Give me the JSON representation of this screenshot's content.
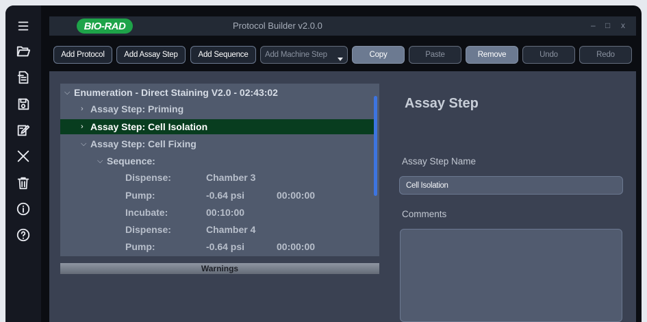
{
  "app": {
    "logo_text": "BIO-RAD",
    "title": "Protocol Builder v2.0.0",
    "window_controls": {
      "minimize": "–",
      "maximize": "□",
      "close": "x"
    },
    "colors": {
      "logo_green": "#1ea349",
      "selected_row": "#083d1f",
      "scrollbar": "#3d74e0",
      "panel": "#505a6d"
    }
  },
  "sidebar": {
    "icons": [
      "menu-icon",
      "open-folder-icon",
      "export-document-icon",
      "save-icon",
      "edit-document-icon",
      "close-icon",
      "delete-icon",
      "info-icon",
      "help-icon"
    ]
  },
  "toolbar": {
    "add_protocol": "Add Protocol",
    "add_assay_step": "Add Assay Step",
    "add_sequence": "Add Sequence",
    "add_machine_step": "Add Machine Step",
    "copy": "Copy",
    "paste": "Paste",
    "remove": "Remove",
    "undo": "Undo",
    "redo": "Redo"
  },
  "tree": {
    "root": "Enumeration - Direct Staining V2.0 - 02:43:02",
    "step1": "Assay Step: Priming",
    "step2": "Assay Step: Cell Isolation",
    "step3": "Assay Step: Cell Fixing",
    "sequence": "Sequence:",
    "rows": [
      {
        "action": "Dispense:",
        "value": "Chamber 3",
        "time": ""
      },
      {
        "action": "Pump:",
        "value": "-0.64 psi",
        "time": "00:00:00"
      },
      {
        "action": "Incubate:",
        "value": "00:10:00",
        "time": ""
      },
      {
        "action": "Dispense:",
        "value": "Chamber 4",
        "time": ""
      },
      {
        "action": "Pump:",
        "value": "-0.64 psi",
        "time": "00:00:00"
      }
    ]
  },
  "warnings": {
    "label": "Warnings"
  },
  "details": {
    "heading": "Assay Step",
    "name_label": "Assay Step Name",
    "name_value": "Cell Isolation",
    "comments_label": "Comments",
    "comments_value": ""
  }
}
